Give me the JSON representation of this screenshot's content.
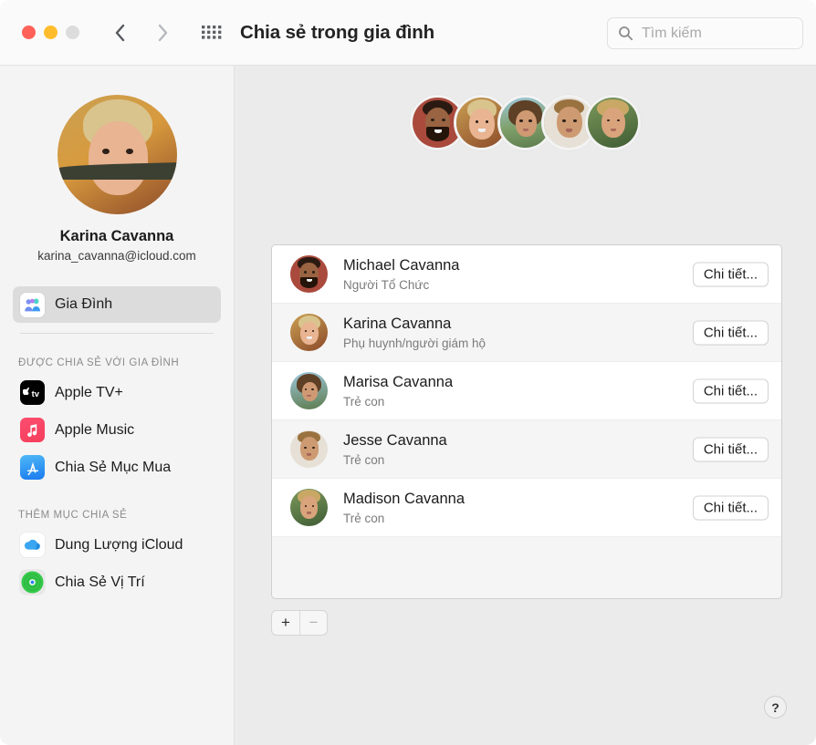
{
  "window": {
    "title": "Chia sẻ trong gia đình",
    "traffic_lights": [
      "close",
      "minimize",
      "zoom"
    ],
    "nav": {
      "back_icon": "chevron-left-icon",
      "forward_icon": "chevron-right-icon",
      "grid_icon": "grid-view-icon"
    }
  },
  "search": {
    "placeholder": "Tìm kiếm",
    "value": "",
    "icon": "search-icon"
  },
  "sidebar": {
    "profile": {
      "name": "Karina Cavanna",
      "email": "karina_cavanna@icloud.com",
      "avatar": "karina-avatar"
    },
    "primary": [
      {
        "label": "Gia Đình",
        "icon": "family-icon",
        "selected": true
      }
    ],
    "sections": [
      {
        "header": "ĐƯỢC CHIA SẺ VỚI GIA ĐÌNH",
        "items": [
          {
            "label": "Apple TV+",
            "icon": "apple-tv-icon"
          },
          {
            "label": "Apple Music",
            "icon": "apple-music-icon"
          },
          {
            "label": "Chia Sẻ Mục Mua",
            "icon": "app-store-icon"
          }
        ]
      },
      {
        "header": "THÊM MỤC CHIA SẺ",
        "items": [
          {
            "label": "Dung Lượng iCloud",
            "icon": "icloud-icon"
          },
          {
            "label": "Chia Sẻ Vị Trí",
            "icon": "find-my-icon"
          }
        ]
      }
    ]
  },
  "main": {
    "title": "Chia sẻ trong gia đình",
    "avatar_stack": [
      "michael",
      "karina",
      "marisa",
      "jesse",
      "madison"
    ],
    "members": [
      {
        "name": "Michael Cavanna",
        "role": "Người Tổ Chức",
        "button": "Chi tiết...",
        "avatar": "michael"
      },
      {
        "name": "Karina Cavanna",
        "role": "Phụ huynh/người giám hộ",
        "button": "Chi tiết...",
        "avatar": "karina"
      },
      {
        "name": "Marisa Cavanna",
        "role": "Trẻ con",
        "button": "Chi tiết...",
        "avatar": "marisa"
      },
      {
        "name": "Jesse Cavanna",
        "role": "Trẻ con",
        "button": "Chi tiết...",
        "avatar": "jesse"
      },
      {
        "name": "Madison Cavanna",
        "role": "Trẻ con",
        "button": "Chi tiết...",
        "avatar": "madison"
      }
    ],
    "toolbar": {
      "add_label": "+",
      "remove_label": "−",
      "remove_disabled": true
    },
    "help_label": "?"
  },
  "colors": {
    "window_bg": "#ebebeb",
    "sidebar_bg": "#f4f4f4",
    "titlebar_bg": "#fafafa",
    "row_alt": "#f5f5f5",
    "accent_blue": "#1a7bef",
    "traffic_red": "#ff6159",
    "traffic_yellow": "#ffbd2e",
    "traffic_gray": "#dcdcdc"
  }
}
